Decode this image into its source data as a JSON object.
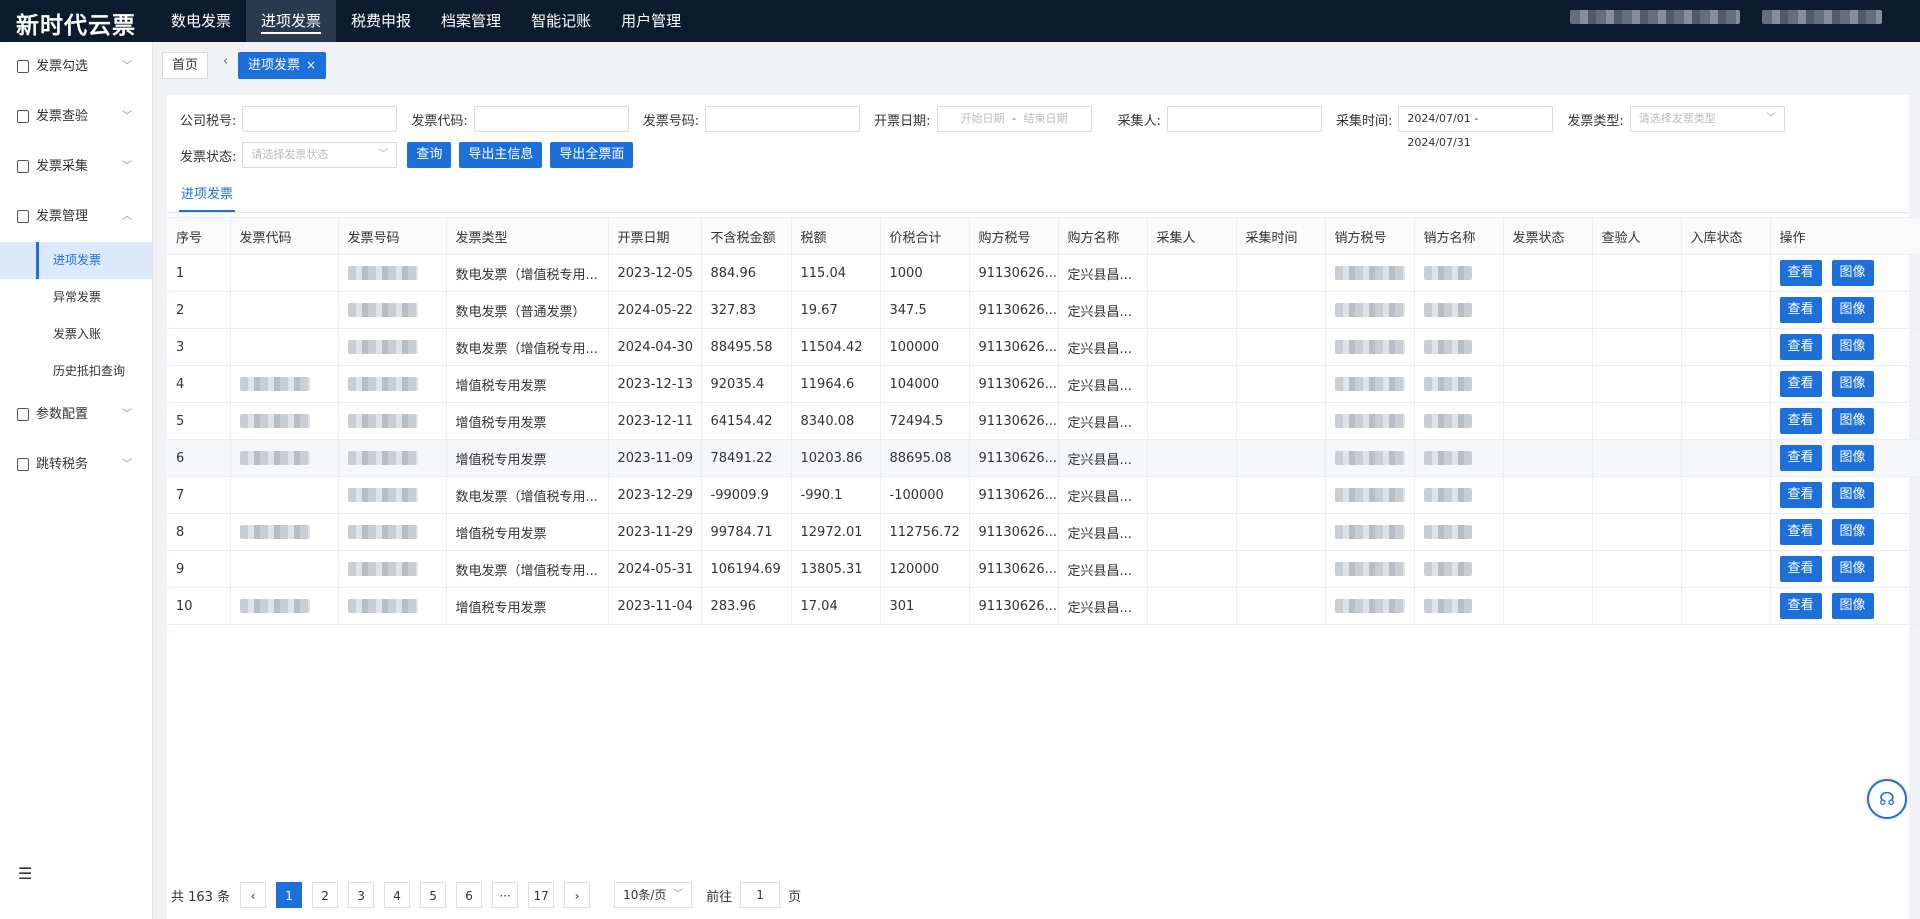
{
  "app": {
    "logo": "新时代云票"
  },
  "nav": [
    {
      "label": "数电发票"
    },
    {
      "label": "进项发票",
      "active": true
    },
    {
      "label": "税费申报"
    },
    {
      "label": "档案管理"
    },
    {
      "label": "智能记账"
    },
    {
      "label": "用户管理"
    }
  ],
  "sidebar": {
    "items": [
      {
        "label": "发票勾选",
        "icon": "grid-icon",
        "chevron": "﹀"
      },
      {
        "label": "发票查验",
        "icon": "doc-icon",
        "chevron": "﹀"
      },
      {
        "label": "发票采集",
        "icon": "collect-icon",
        "chevron": "﹀"
      },
      {
        "label": "发票管理",
        "icon": "search-icon",
        "chevron": "︿"
      }
    ],
    "subitems": [
      {
        "label": "进项发票",
        "active": true
      },
      {
        "label": "异常发票"
      },
      {
        "label": "发票入账"
      },
      {
        "label": "历史抵扣查询"
      }
    ],
    "items2": [
      {
        "label": "参数配置",
        "icon": "config-icon",
        "chevron": "﹀"
      },
      {
        "label": "跳转税务",
        "icon": "jump-icon",
        "chevron": "﹀"
      }
    ]
  },
  "tabs": {
    "home": "首页",
    "active": "进项发票",
    "close": "×"
  },
  "filters": {
    "company_tax_label": "公司税号:",
    "invoice_code_label": "发票代码:",
    "invoice_number_label": "发票号码:",
    "issue_date_label": "开票日期:",
    "issue_date_start": "开始日期",
    "issue_date_sep": "-",
    "issue_date_end": "结束日期",
    "collector_label": "采集人:",
    "collect_time_label": "采集时间:",
    "collect_time_value": "2024/07/01 - 2024/07/31",
    "invoice_type_label": "发票类型:",
    "invoice_type_placeholder": "请选择发票类型",
    "invoice_status_label": "发票状态:",
    "invoice_status_placeholder": "请选择发票状态",
    "query_btn": "查询",
    "export_main_btn": "导出主信息",
    "export_full_btn": "导出全票面"
  },
  "subtab": "进项发票",
  "table": {
    "headers": [
      "序号",
      "发票代码",
      "发票号码",
      "发票类型",
      "开票日期",
      "不含税金额",
      "税额",
      "价税合计",
      "购方税号",
      "购方名称",
      "采集人",
      "采集时间",
      "销方税号",
      "销方名称",
      "发票状态",
      "查验人",
      "入库状态",
      "操作"
    ],
    "view_btn": "查看",
    "image_btn": "图像",
    "rows": [
      {
        "no": "1",
        "type": "数电发票（增值税专用...",
        "date": "2023-12-05",
        "amount": "884.96",
        "tax": "115.04",
        "total": "1000",
        "buyer_tax": "91130626...",
        "buyer_name": "定兴县昌...",
        "code_blur": false
      },
      {
        "no": "2",
        "type": "数电发票（普通发票）",
        "date": "2024-05-22",
        "amount": "327.83",
        "tax": "19.67",
        "total": "347.5",
        "buyer_tax": "91130626...",
        "buyer_name": "定兴县昌...",
        "code_blur": false
      },
      {
        "no": "3",
        "type": "数电发票（增值税专用...",
        "date": "2024-04-30",
        "amount": "88495.58",
        "tax": "11504.42",
        "total": "100000",
        "buyer_tax": "91130626...",
        "buyer_name": "定兴县昌...",
        "code_blur": false
      },
      {
        "no": "4",
        "type": "增值税专用发票",
        "date": "2023-12-13",
        "amount": "92035.4",
        "tax": "11964.6",
        "total": "104000",
        "buyer_tax": "91130626...",
        "buyer_name": "定兴县昌...",
        "code_blur": true
      },
      {
        "no": "5",
        "type": "增值税专用发票",
        "date": "2023-12-11",
        "amount": "64154.42",
        "tax": "8340.08",
        "total": "72494.5",
        "buyer_tax": "91130626...",
        "buyer_name": "定兴县昌...",
        "code_blur": true
      },
      {
        "no": "6",
        "type": "增值税专用发票",
        "date": "2023-11-09",
        "amount": "78491.22",
        "tax": "10203.86",
        "total": "88695.08",
        "buyer_tax": "91130626...",
        "buyer_name": "定兴县昌...",
        "code_blur": true,
        "hl": true
      },
      {
        "no": "7",
        "type": "数电发票（增值税专用...",
        "date": "2023-12-29",
        "amount": "-99009.9",
        "tax": "-990.1",
        "total": "-100000",
        "buyer_tax": "91130626...",
        "buyer_name": "定兴县昌...",
        "code_blur": false
      },
      {
        "no": "8",
        "type": "增值税专用发票",
        "date": "2023-11-29",
        "amount": "99784.71",
        "tax": "12972.01",
        "total": "112756.72",
        "buyer_tax": "91130626...",
        "buyer_name": "定兴县昌...",
        "code_blur": true
      },
      {
        "no": "9",
        "type": "数电发票（增值税专用...",
        "date": "2024-05-31",
        "amount": "106194.69",
        "tax": "13805.31",
        "total": "120000",
        "buyer_tax": "91130626...",
        "buyer_name": "定兴县昌...",
        "code_blur": false
      },
      {
        "no": "10",
        "type": "增值税专用发票",
        "date": "2023-11-04",
        "amount": "283.96",
        "tax": "17.04",
        "total": "301",
        "buyer_tax": "91130626...",
        "buyer_name": "定兴县昌...",
        "code_blur": true
      }
    ]
  },
  "pagination": {
    "total": "共 163 条",
    "prev": "‹",
    "pages": [
      "1",
      "2",
      "3",
      "4",
      "5",
      "6"
    ],
    "ellipsis": "···",
    "last": "17",
    "next": "›",
    "page_size": "10条/页",
    "goto_label": "前往",
    "goto_value": "1",
    "goto_suffix": "页",
    "current": "1"
  }
}
